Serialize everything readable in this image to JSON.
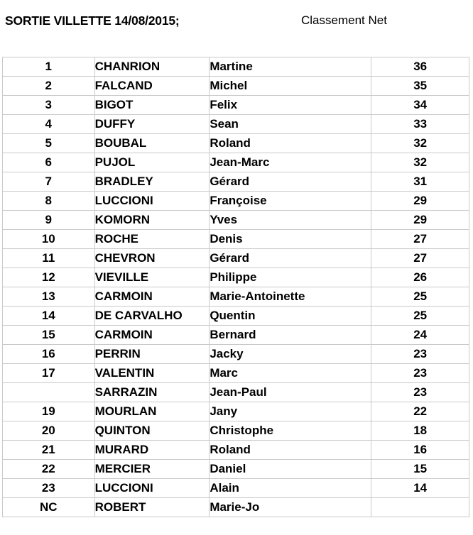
{
  "document": {
    "title": "SORTIE VILLETTE 14/08/2015;",
    "subtitle": "Classement Net"
  },
  "table": {
    "columns": [
      "rank",
      "lastname",
      "firstname",
      "score"
    ],
    "rows": [
      {
        "rank": "1",
        "lastname": "CHANRION",
        "firstname": "Martine",
        "score": "36"
      },
      {
        "rank": "2",
        "lastname": "FALCAND",
        "firstname": "Michel",
        "score": "35"
      },
      {
        "rank": "3",
        "lastname": "BIGOT",
        "firstname": "Felix",
        "score": "34"
      },
      {
        "rank": "4",
        "lastname": "DUFFY",
        "firstname": "Sean",
        "score": "33"
      },
      {
        "rank": "5",
        "lastname": "BOUBAL",
        "firstname": "Roland",
        "score": "32"
      },
      {
        "rank": "6",
        "lastname": "PUJOL",
        "firstname": "Jean-Marc",
        "score": "32"
      },
      {
        "rank": "7",
        "lastname": "BRADLEY",
        "firstname": "Gérard",
        "score": "31"
      },
      {
        "rank": "8",
        "lastname": "LUCCIONI",
        "firstname": "Françoise",
        "score": "29"
      },
      {
        "rank": "9",
        "lastname": "KOMORN",
        "firstname": "Yves",
        "score": "29"
      },
      {
        "rank": "10",
        "lastname": "ROCHE",
        "firstname": "Denis",
        "score": "27"
      },
      {
        "rank": "11",
        "lastname": "CHEVRON",
        "firstname": "Gérard",
        "score": "27"
      },
      {
        "rank": "12",
        "lastname": "VIEVILLE",
        "firstname": "Philippe",
        "score": "26"
      },
      {
        "rank": "13",
        "lastname": "CARMOIN",
        "firstname": "Marie-Antoinette",
        "score": "25"
      },
      {
        "rank": "14",
        "lastname": "DE CARVALHO",
        "firstname": "Quentin",
        "score": "25"
      },
      {
        "rank": "15",
        "lastname": "CARMOIN",
        "firstname": "Bernard",
        "score": "24"
      },
      {
        "rank": "16",
        "lastname": "PERRIN",
        "firstname": "Jacky",
        "score": "23"
      },
      {
        "rank": "17",
        "lastname": "VALENTIN",
        "firstname": "Marc",
        "score": "23"
      },
      {
        "rank": "",
        "lastname": "SARRAZIN",
        "firstname": "Jean-Paul",
        "score": "23"
      },
      {
        "rank": "19",
        "lastname": "MOURLAN",
        "firstname": "Jany",
        "score": "22"
      },
      {
        "rank": "20",
        "lastname": "QUINTON",
        "firstname": "Christophe",
        "score": "18"
      },
      {
        "rank": "21",
        "lastname": "MURARD",
        "firstname": "Roland",
        "score": "16"
      },
      {
        "rank": "22",
        "lastname": "MERCIER",
        "firstname": "Daniel",
        "score": "15"
      },
      {
        "rank": "23",
        "lastname": "LUCCIONI",
        "firstname": "Alain",
        "score": "14"
      },
      {
        "rank": "NC",
        "lastname": "ROBERT",
        "firstname": "Marie-Jo",
        "score": ""
      }
    ]
  },
  "colors": {
    "text": "#000000",
    "grid": "#c9c9c9",
    "background": "#ffffff"
  }
}
